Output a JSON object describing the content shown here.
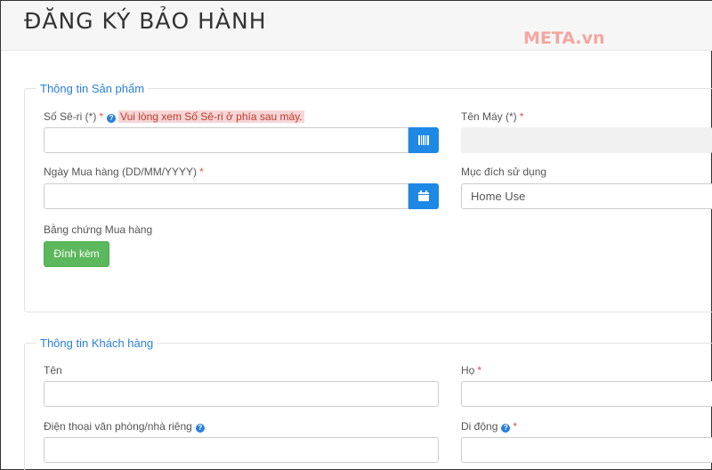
{
  "header": {
    "title": "ĐĂNG KÝ BẢO HÀNH",
    "watermark": "META.vn"
  },
  "product_section": {
    "legend": "Thông tin Sản phẩm",
    "serial": {
      "label": "Số Sê-ri (*)",
      "required": "*",
      "hint": "Vui lòng xem Số Sê-ri ở phía sau máy.",
      "value": "",
      "button_icon": "barcode-icon"
    },
    "model_name": {
      "label": "Tên Máy (*)",
      "required": "*",
      "value": ""
    },
    "purchase_date": {
      "label": "Ngày Mua hàng (DD/MM/YYYY)",
      "required": "*",
      "value": "",
      "button_icon": "calendar-icon"
    },
    "purpose": {
      "label": "Mục đích sử dụng",
      "selected": "Home Use"
    },
    "proof": {
      "label": "Bằng chứng Mua hàng",
      "button_label": "Đính kèm"
    }
  },
  "customer_section": {
    "legend": "Thông tin Khách hàng",
    "first_name": {
      "label": "Tên",
      "value": ""
    },
    "last_name": {
      "label": "Họ",
      "required": "*",
      "value": ""
    },
    "office_phone": {
      "label": "Điện thoại văn phòng/nhà riêng",
      "value": ""
    },
    "mobile": {
      "label": "Di động",
      "required": "*",
      "value": ""
    }
  },
  "colors": {
    "accent": "#1e88e5",
    "attach": "#5cb85c",
    "required": "#d9534f"
  }
}
